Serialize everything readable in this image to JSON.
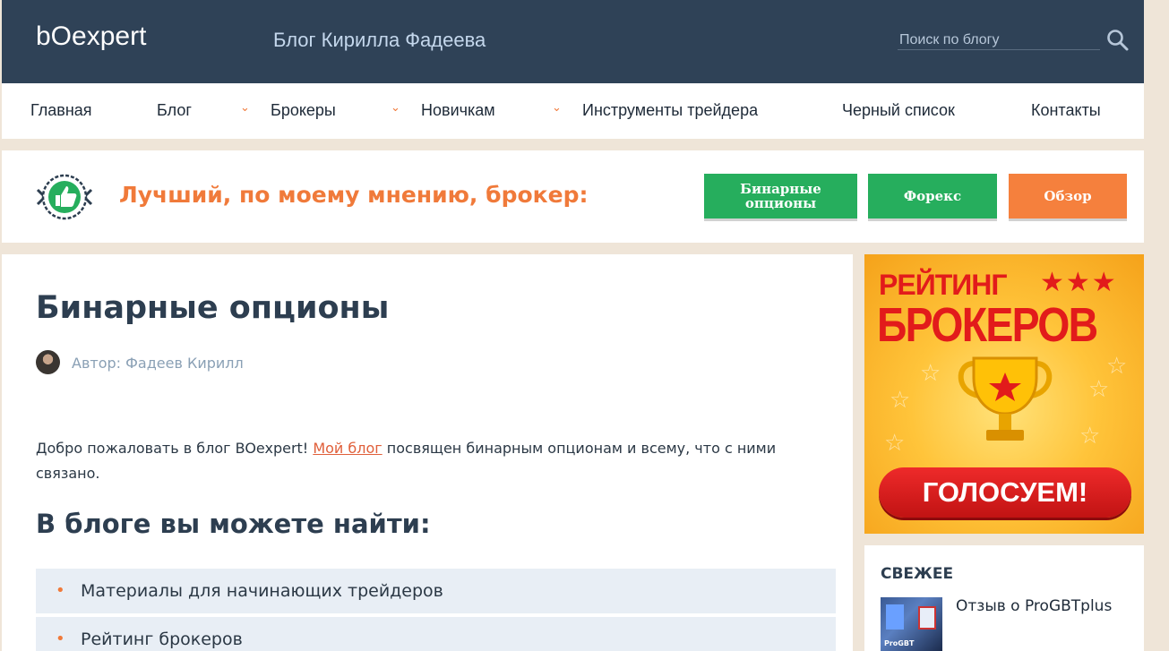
{
  "header": {
    "logo": "bOexpert",
    "site_title": "Блог Кирилла Фадеева",
    "search_placeholder": "Поиск по блогу"
  },
  "nav": {
    "items": [
      {
        "label": "Главная",
        "has_dropdown": false
      },
      {
        "label": "Блог",
        "has_dropdown": true
      },
      {
        "label": "Брокеры",
        "has_dropdown": true
      },
      {
        "label": "Новичкам",
        "has_dropdown": true
      },
      {
        "label": "Инструменты трейдера",
        "has_dropdown": false
      },
      {
        "label": "Черный список",
        "has_dropdown": false
      },
      {
        "label": "Контакты",
        "has_dropdown": false
      }
    ]
  },
  "best_broker": {
    "text": "Лучший, по моему мнению, брокер:",
    "buttons": [
      {
        "label": "Бинарные опционы",
        "color": "#26ae5d"
      },
      {
        "label": "Форекс",
        "color": "#26ae5d"
      },
      {
        "label": "Обзор",
        "color": "#f5803d"
      }
    ]
  },
  "article": {
    "title": "Бинарные опционы",
    "author": "Автор: Фадеев Кирилл",
    "intro_before": "Добро пожаловать в блог BOexpert! ",
    "intro_link": "Мой блог",
    "intro_after": " посвящен бинарным опционам и всему, что с ними связано.",
    "subtitle": "В блоге вы можете найти:",
    "list": [
      "Материалы для начинающих трейдеров",
      "Рейтинг брокеров"
    ]
  },
  "sidebar": {
    "banner": {
      "line1": "РЕЙТИНГ",
      "line2": "БРОКЕРОВ",
      "button": "ГОЛОСУЕМ!"
    },
    "fresh": {
      "title": "СВЕЖЕЕ",
      "items": [
        {
          "title": "Отзыв о ProGBTplus",
          "thumb_text": "ProGBT"
        }
      ]
    }
  },
  "colors": {
    "header_bg": "#2f4257",
    "accent_orange": "#f07a3a",
    "accent_green": "#26ae5d",
    "page_bg": "#efe5d8"
  }
}
